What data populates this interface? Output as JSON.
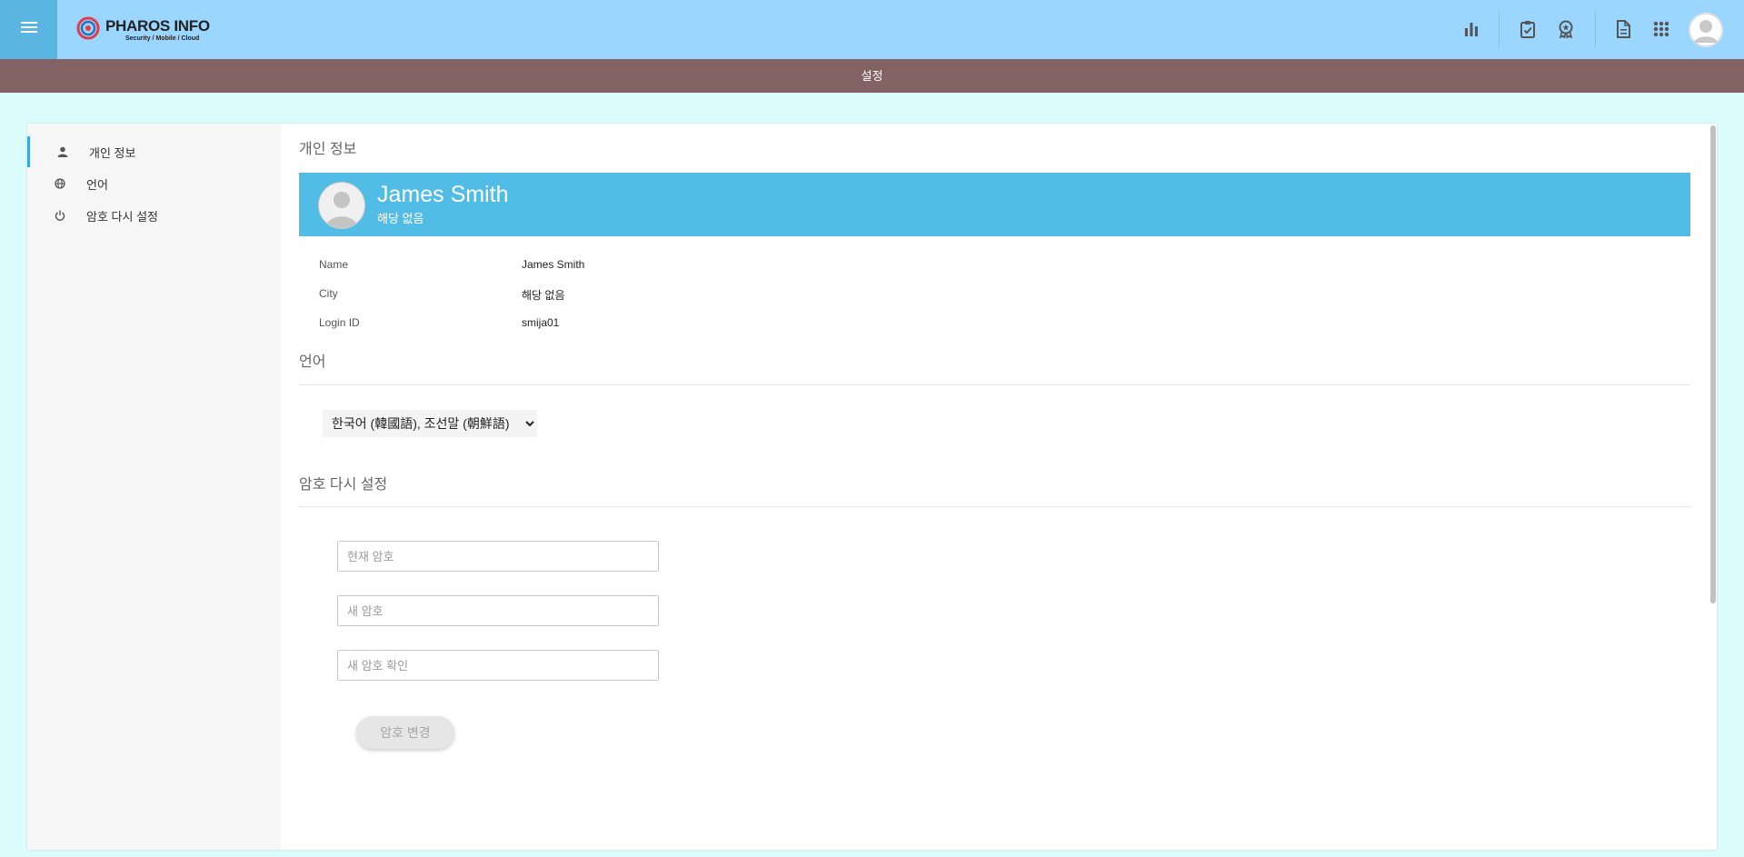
{
  "header": {
    "logo": {
      "name": "PHAROS INFO",
      "tagline": "Security / Mobile / Cloud"
    },
    "icons": [
      "menu-icon",
      "bar-chart-icon",
      "clipboard-check-icon",
      "award-icon",
      "document-icon",
      "apps-grid-icon",
      "user-avatar-icon"
    ]
  },
  "page_title": "설정",
  "sidebar": {
    "items": [
      {
        "label": "개인 정보",
        "icon": "person-icon",
        "active": true
      },
      {
        "label": "언어",
        "icon": "globe-icon",
        "active": false
      },
      {
        "label": "암호 다시 설정",
        "icon": "power-icon",
        "active": false
      }
    ]
  },
  "profile": {
    "section_title": "개인 정보",
    "name": "James Smith",
    "subtitle": "해당 없음",
    "fields": [
      {
        "label": "Name",
        "value": "James Smith"
      },
      {
        "label": "City",
        "value": "해당 없음"
      },
      {
        "label": "Login ID",
        "value": "smija01"
      }
    ]
  },
  "language": {
    "section_title": "언어",
    "selected": "한국어 (韓國語), 조선말 (朝鮮語)"
  },
  "password": {
    "section_title": "암호 다시 설정",
    "current_placeholder": "현재 암호",
    "new_placeholder": "새 암호",
    "confirm_placeholder": "새 암호 확인",
    "submit_label": "암호 변경"
  },
  "colors": {
    "topbar": "#9ad6ff",
    "menu_button": "#5ab6e0",
    "title_strip": "#826262",
    "profile_card": "#51bde6",
    "active_accent": "#3ba6e0",
    "page_background": "#dcfbfb"
  }
}
